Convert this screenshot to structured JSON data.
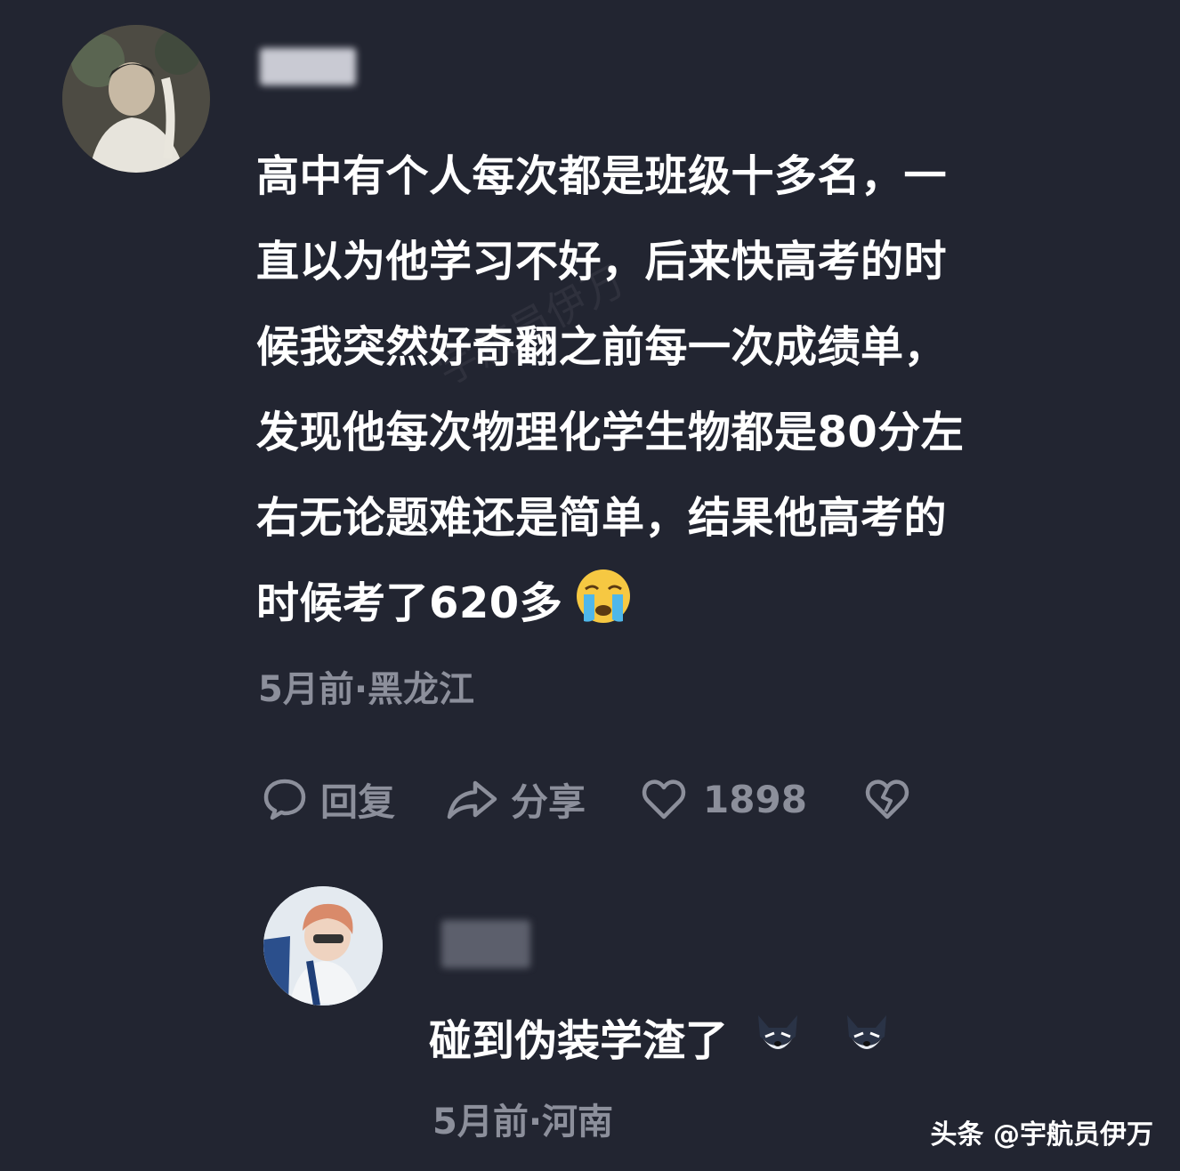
{
  "comments": [
    {
      "avatar_icon": "user-avatar-icon",
      "lines": [
        "高中有个人每次都是班级十多名，一",
        "直以为他学习不好，后来快高考的时",
        "候我突然好奇翻之前每一次成绩单，",
        "发现他每次物理化学生物都是80分左",
        "右无论题难还是简单，结果他高考的",
        "时候考了620多"
      ],
      "emoji": "loudly-crying-face-icon",
      "meta": "5月前·黑龙江",
      "actions": {
        "reply_label": "回复",
        "share_label": "分享",
        "like_count": "1898",
        "reply_icon": "comment-bubble-icon",
        "share_icon": "share-arrow-icon",
        "like_icon": "heart-icon",
        "dislike_icon": "broken-heart-icon"
      }
    },
    {
      "avatar_icon": "user-avatar-icon",
      "text": "碰到伪装学渣了",
      "emojis": [
        "dog-face-icon",
        "dog-face-icon"
      ],
      "meta": "5月前·河南"
    }
  ],
  "watermark": {
    "text": "头条 @宇航员伊万"
  },
  "colors": {
    "background": "#222531",
    "text": "#ffffff",
    "meta_text": "#8c8f9b"
  }
}
